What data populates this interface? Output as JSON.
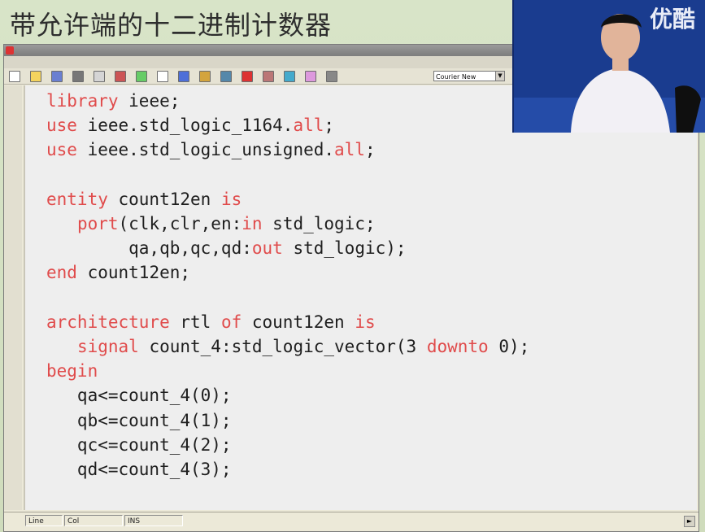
{
  "slide": {
    "title": "带允许端的十二进制计数器"
  },
  "overlay": {
    "logo_text": "优酷"
  },
  "toolbar": {
    "font_name": "Courier New"
  },
  "code_lines": [
    [
      [
        "kw",
        "library"
      ],
      [
        "t",
        " ieee;"
      ]
    ],
    [
      [
        "kw",
        "use"
      ],
      [
        "t",
        " ieee.std_logic_1164."
      ],
      [
        "kw",
        "all"
      ],
      [
        "t",
        ";"
      ]
    ],
    [
      [
        "kw",
        "use"
      ],
      [
        "t",
        " ieee.std_logic_unsigned."
      ],
      [
        "kw",
        "all"
      ],
      [
        "t",
        ";"
      ]
    ],
    [],
    [
      [
        "kw",
        "entity"
      ],
      [
        "t",
        " count12en "
      ],
      [
        "kw",
        "is"
      ]
    ],
    [
      [
        "t",
        "   "
      ],
      [
        "kw",
        "port"
      ],
      [
        "t",
        "(clk,clr,en:"
      ],
      [
        "kw",
        "in"
      ],
      [
        "t",
        " std_logic;"
      ]
    ],
    [
      [
        "t",
        "        qa,qb,qc,qd:"
      ],
      [
        "kw",
        "out"
      ],
      [
        "t",
        " std_logic);"
      ]
    ],
    [
      [
        "kw",
        "end"
      ],
      [
        "t",
        " count12en;"
      ]
    ],
    [],
    [
      [
        "kw",
        "architecture"
      ],
      [
        "t",
        " rtl "
      ],
      [
        "kw",
        "of"
      ],
      [
        "t",
        " count12en "
      ],
      [
        "kw",
        "is"
      ]
    ],
    [
      [
        "t",
        "   "
      ],
      [
        "kw",
        "signal"
      ],
      [
        "t",
        " count_4:std_logic_vector(3 "
      ],
      [
        "kw",
        "downto"
      ],
      [
        "t",
        " 0);"
      ]
    ],
    [
      [
        "kw",
        "begin"
      ]
    ],
    [
      [
        "t",
        "   qa<=count_4(0);"
      ]
    ],
    [
      [
        "t",
        "   qb<=count_4(1);"
      ]
    ],
    [
      [
        "t",
        "   qc<=count_4(2);"
      ]
    ],
    [
      [
        "t",
        "   qd<=count_4(3);"
      ]
    ]
  ],
  "status": {
    "line_label": "Line",
    "col_label": "Col",
    "ins_label": "INS"
  },
  "colors": {
    "keyword": "#e04b4b",
    "text": "#1e1e1e",
    "editor_bg": "#eeeeee"
  },
  "icons": {
    "toolbar": [
      "new-file-icon",
      "open-icon",
      "save-icon",
      "print-icon",
      "cut-icon",
      "copy-icon",
      "paste-icon",
      "undo-icon",
      "help-icon",
      "compile-icon",
      "run-icon",
      "stop-icon",
      "debug-icon",
      "breakpoint-icon",
      "window-icon",
      "settings-icon"
    ]
  }
}
